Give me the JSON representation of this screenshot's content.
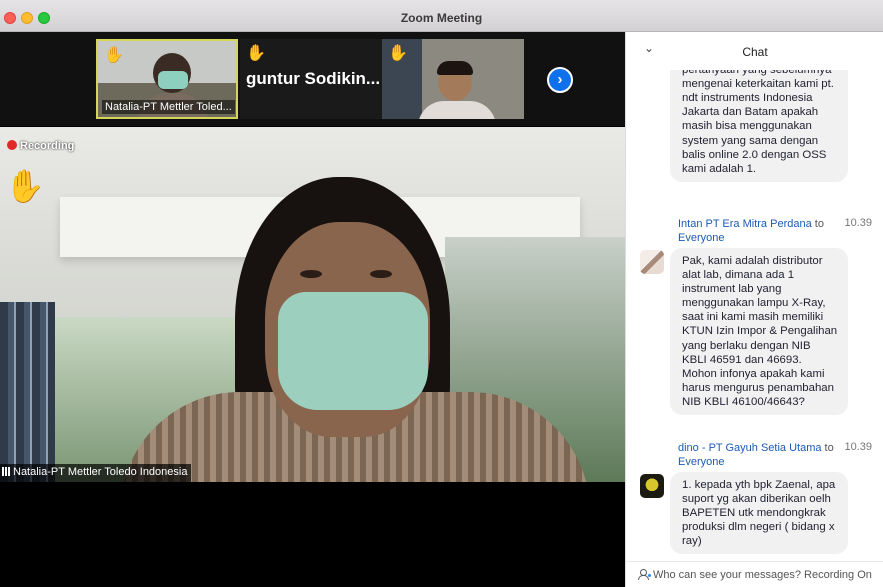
{
  "window": {
    "title": "Zoom Meeting"
  },
  "thumbnails": [
    {
      "name": "Natalia-PT Mettler Toled...",
      "hand": "✋"
    },
    {
      "name": "guntur Sodikin...",
      "hand": "✋"
    },
    {
      "name": "",
      "hand": "✋"
    }
  ],
  "main_video": {
    "recording_label": "Recording",
    "hand": "✋",
    "participant_name": "Natalia-PT Mettler Toledo Indonesia"
  },
  "chat": {
    "title": "Chat",
    "collapse_icon": "chevron-down",
    "messages": [
      {
        "text": "saya ingin menanyakan masih pertanyaan yang sebelumnya mengenai keterkaitan kami pt. ndt instruments Indonesia Jakarta dan Batam apakah masih bisa menggunakan system yang sama dengan balis online 2.0 dengan OSS kami adalah 1."
      },
      {
        "sender": "Intan PT Era Mitra Perdana",
        "to_word": "to",
        "recipient": "Everyone",
        "time": "10.39",
        "text": "Pak, kami adalah distributor alat lab, dimana ada 1 instrument lab yang menggunakan lampu X-Ray, saat ini kami masih memiliki KTUN Izin Impor & Pengalihan yang berlaku dengan NIB KBLI 46591 dan 46693. Mohon infonya apakah kami harus mengurus penambahan NIB KBLI 46100/46643?"
      },
      {
        "sender": "dino - PT Gayuh Setia Utama",
        "to_word": "to",
        "recipient": "Everyone",
        "time": "10.39",
        "text": "1. kepada yth bpk Zaenal, apa suport yg akan diberikan oelh BAPETEN utk mendongkrak produksi dlm negeri ( bidang x ray)"
      }
    ],
    "footer": "Who can see your messages? Recording On"
  }
}
